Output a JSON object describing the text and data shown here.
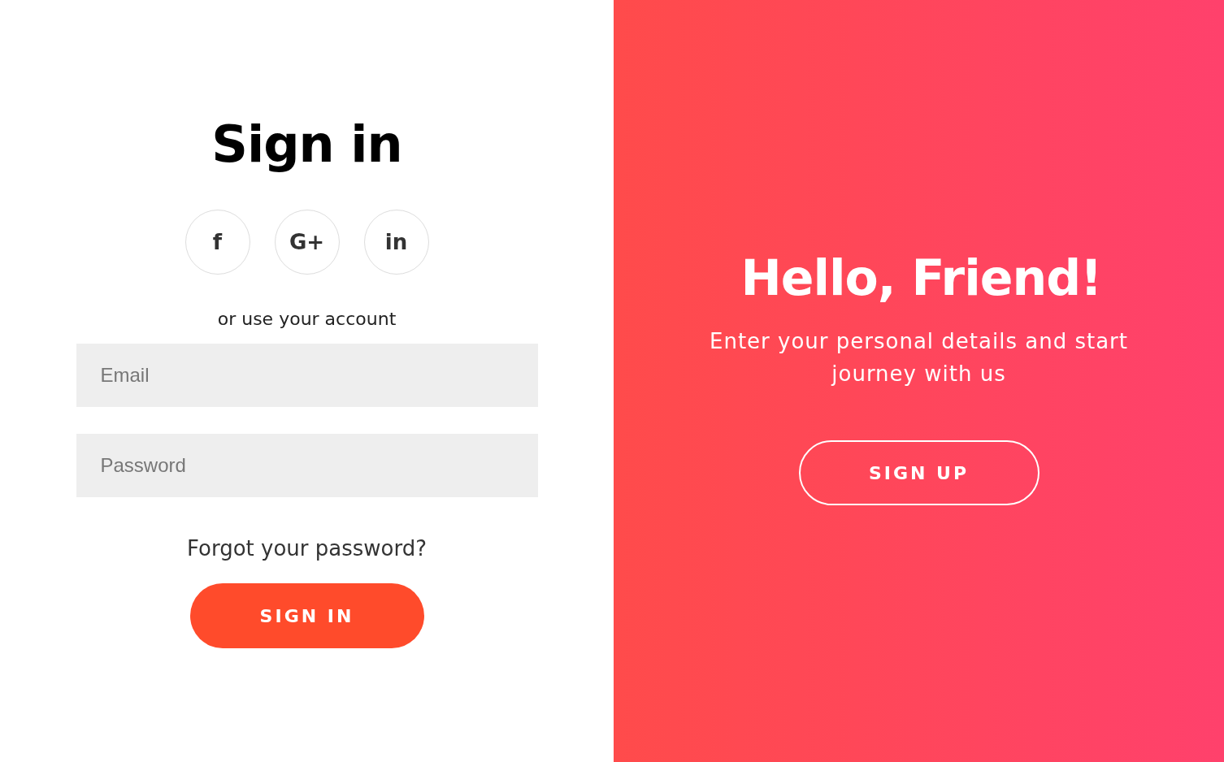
{
  "sign_in": {
    "title": "Sign in",
    "social_buttons": [
      {
        "label": "f"
      },
      {
        "label": "G+"
      },
      {
        "label": "in"
      }
    ],
    "divider_text": "or use your account",
    "fields": [
      {
        "placeholder": "Email"
      },
      {
        "placeholder": "Password"
      }
    ],
    "forgot_link": "Forgot your password?",
    "button": "SIGN IN"
  },
  "overlay": {
    "title": "Hello, Friend!",
    "text": "Enter your personal details and start journey with us",
    "button": "SIGN UP"
  }
}
